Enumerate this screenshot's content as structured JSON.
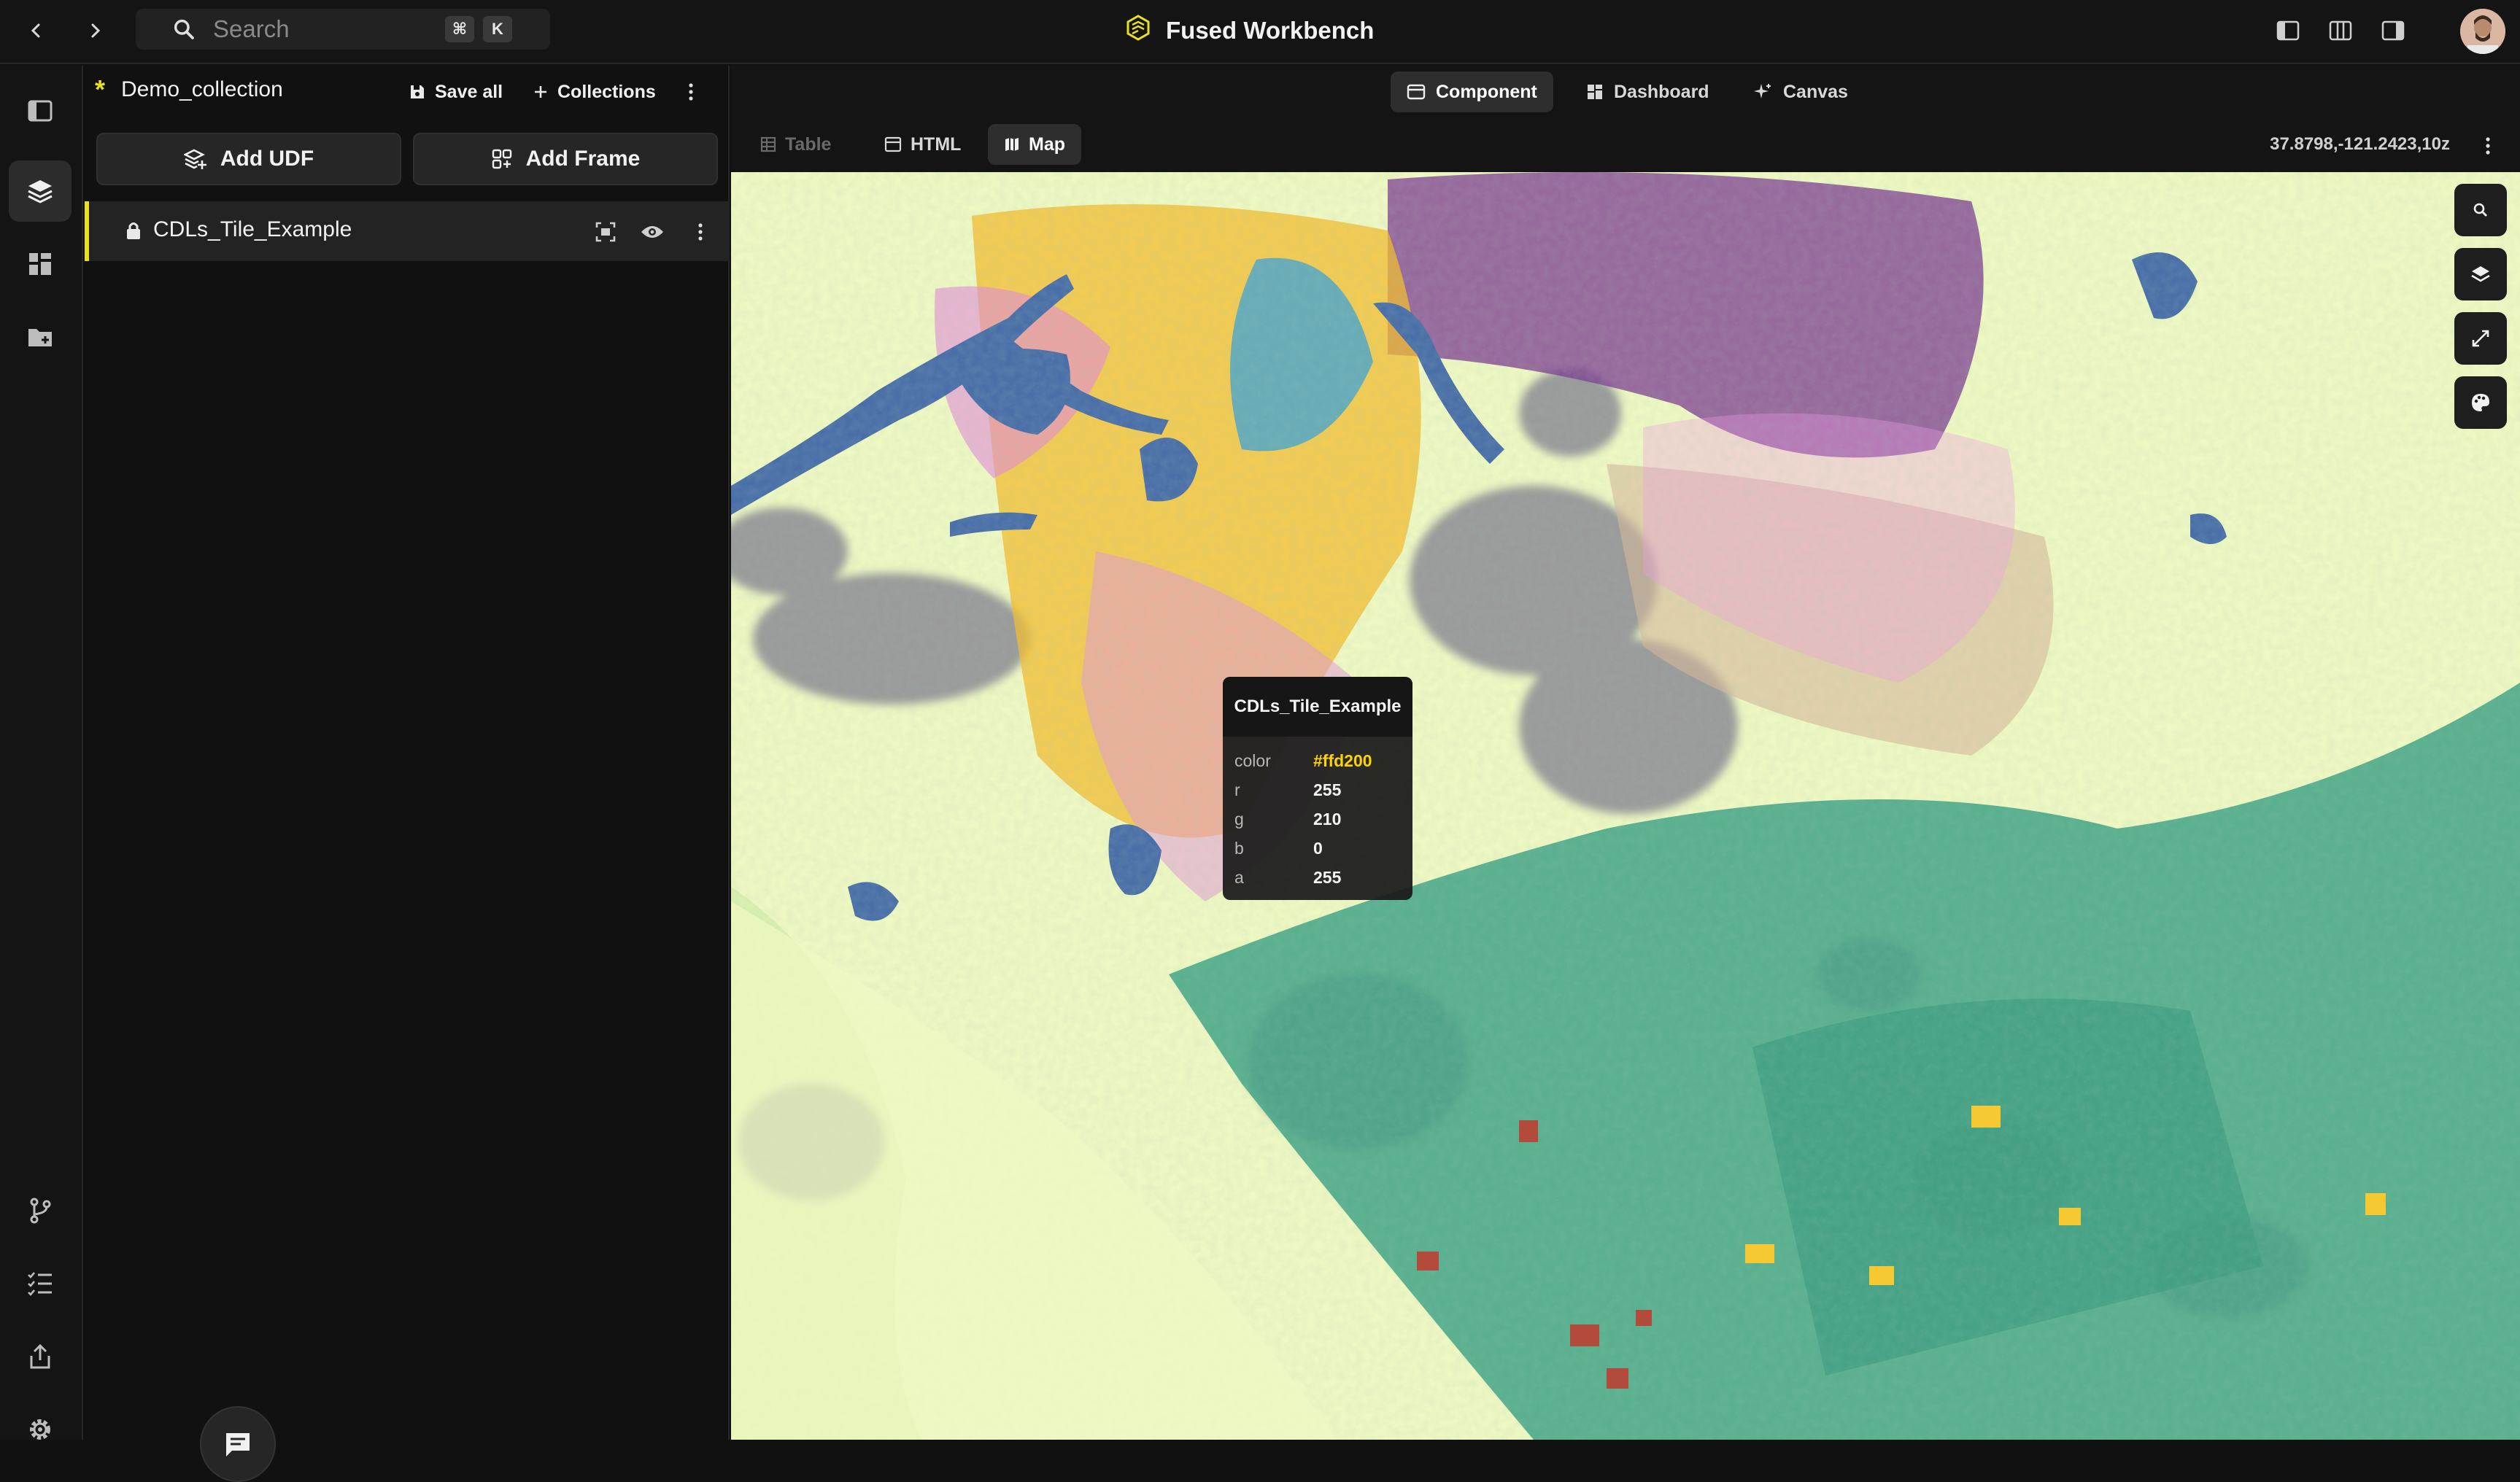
{
  "topbar": {
    "search_placeholder": "Search",
    "shortcut_mod": "⌘",
    "shortcut_key": "K",
    "app_title": "Fused Workbench"
  },
  "panel": {
    "collection_name": "Demo_collection",
    "save_all": "Save all",
    "collections": "Collections",
    "add_udf": "Add UDF",
    "add_frame": "Add Frame",
    "udf_name": "CDLs_Tile_Example"
  },
  "view_tabs": [
    "Component",
    "Dashboard",
    "Canvas"
  ],
  "render_tabs": [
    "Table",
    "HTML",
    "Map"
  ],
  "map": {
    "coordinates": "37.8798,-121.2423,10z"
  },
  "tooltip": {
    "title": "CDLs_Tile_Example",
    "rows": [
      {
        "key": "color",
        "value": "#ffd200"
      },
      {
        "key": "r",
        "value": "255"
      },
      {
        "key": "g",
        "value": "210"
      },
      {
        "key": "b",
        "value": "0"
      },
      {
        "key": "a",
        "value": "255"
      }
    ]
  },
  "colors": {
    "accent_yellow": "#e8e020",
    "tooltip_color_value": "#ffd200",
    "map_background": "#eef8c2"
  }
}
